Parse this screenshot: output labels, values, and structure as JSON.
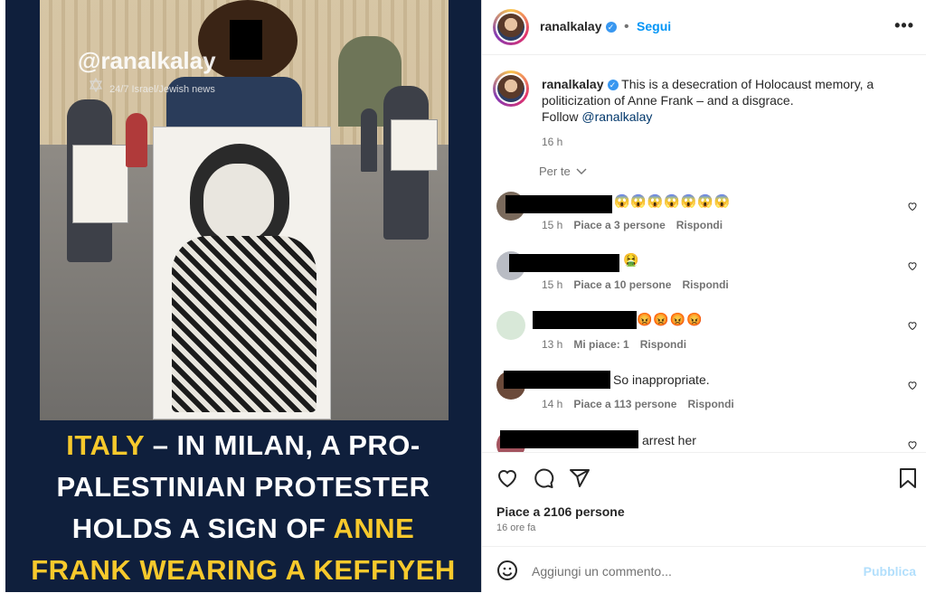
{
  "post_image": {
    "watermark_handle": "@ranalkalay",
    "watermark_sub": "24/7 Israel/Jewish news",
    "headline": {
      "line1_yellow": "ITALY",
      "line1_rest": " – IN MILAN, A PRO-",
      "line2": "PALESTINIAN PROTESTER",
      "line3_start": "HOLDS A SIGN OF ",
      "line3_yellow": "ANNE",
      "line4_yellow": "FRANK WEARING A KEFFIYEH"
    },
    "colors": {
      "background": "#0f1f3c",
      "accent": "#f7c92c"
    }
  },
  "header": {
    "username": "ranalkalay",
    "separator": "•",
    "follow_label": "Segui",
    "more_icon": "more-horizontal-icon"
  },
  "caption": {
    "username": "ranalkalay",
    "text": "This is a desecration of Holocaust memory, a politicization of Anne Frank – and a disgrace.",
    "follow_prefix": "Follow ",
    "follow_link": "@ranalkalay",
    "time": "16 h"
  },
  "filter": {
    "label": "Per te"
  },
  "comments": [
    {
      "text": "",
      "emojis": "😱😱😱😱😱😱😱",
      "time": "15 h",
      "likes": "Piace a 3 persone",
      "reply": "Rispondi"
    },
    {
      "text": "",
      "emojis": "🤮",
      "time": "15 h",
      "likes": "Piace a 10 persone",
      "reply": "Rispondi"
    },
    {
      "text": "",
      "emojis": "😡😡😡😡",
      "time": "13 h",
      "likes": "Mi piace: 1",
      "reply": "Rispondi"
    },
    {
      "text": "So inappropriate.",
      "emojis": "",
      "time": "14 h",
      "likes": "Piace a 113 persone",
      "reply": "Rispondi"
    },
    {
      "text": "arrest her",
      "emojis": "",
      "time": "",
      "likes": "",
      "reply": ""
    }
  ],
  "actions": {
    "likes_label": "Piace a 2106 persone",
    "time_label": "16 ore fa"
  },
  "add_comment": {
    "placeholder": "Aggiungi un commento...",
    "publish_label": "Pubblica"
  }
}
